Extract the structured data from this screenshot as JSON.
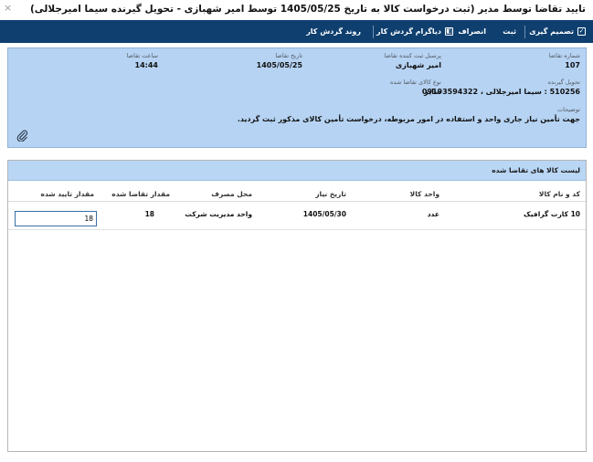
{
  "window": {
    "title": "تایید تقاضا توسط مدیر (ثبت درخواست کالا به تاریخ 1405/05/25 توسط امیر شهبازی - تحویل گیرنده سیما امیرجلالی)",
    "close_glyph": "×"
  },
  "toolbar": {
    "decision": "تصمیم گیری",
    "submit": "ثبت",
    "cancel": "انصراف",
    "workflow_diagram": "دیاگرام گردش کار",
    "workflow_process": "روند گردش کار"
  },
  "request": {
    "number_label": "شماره تقاضا",
    "number": "107",
    "registrant_label": "پرسنل ثبت کننده تقاضا",
    "registrant": "امیر شهبازی",
    "date_label": "تاریخ تقاضا",
    "date": "1405/05/25",
    "time_label": "ساعت تقاضا",
    "time": "14:44",
    "receiver_label": "تحویل گیرنده",
    "receiver": "510256 : سیما امیرجلالی ، 09193594322",
    "goods_type_label": "نوع کالای تقاضا شده",
    "goods_type": "سایر",
    "notes_label": "توضیحات",
    "notes": "جهت تأمین نیاز جاری واحد و استفاده در امور مربوطه، درخواست تأمین کالای مذکور ثبت گردید."
  },
  "items_list": {
    "title": "لیست کالا های تقاضا شده",
    "columns": {
      "code_name": "کد و نام کالا",
      "unit": "واحد کالا",
      "need_date": "تاریخ نیاز",
      "usage_place": "محل مصرف",
      "requested_qty": "مقدار تقاضا شده",
      "approved_qty": "مقدار تایید شده"
    },
    "rows": [
      {
        "code_name": "10 کارت گرافیک",
        "unit": "عدد",
        "need_date": "1405/05/30",
        "usage_place": "واحد مدیریت شرکت",
        "requested_qty": "18",
        "approved_qty": "18"
      }
    ]
  },
  "icons": {
    "decision": "checkbox-icon",
    "workflow_diagram": "diagram-icon",
    "attachment": "paperclip-icon"
  },
  "colors": {
    "toolbar_bg": "#0f3f6f",
    "info_panel_bg": "#b6d3f3",
    "list_header_bg": "#b9d6f5"
  }
}
